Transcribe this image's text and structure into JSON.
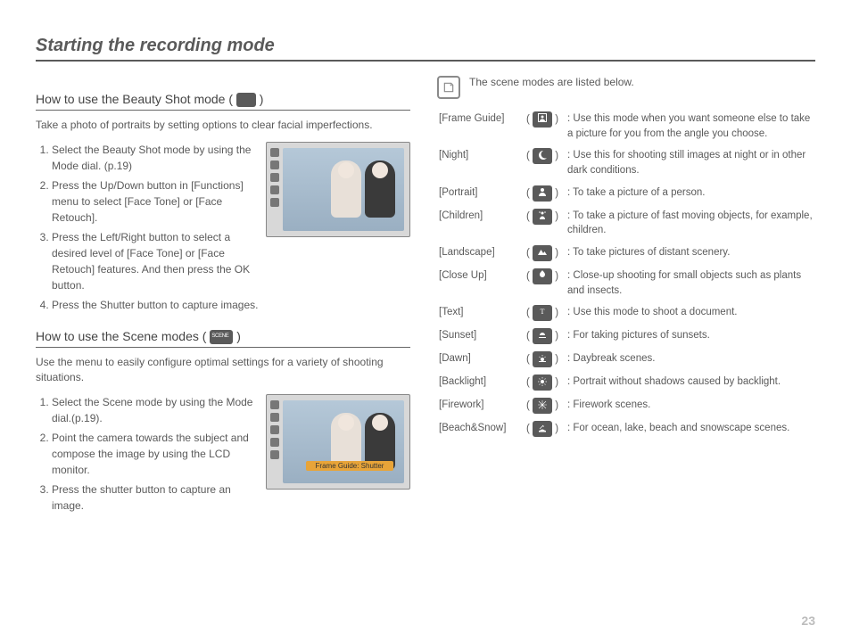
{
  "title": "Starting the recording mode",
  "page_number": "23",
  "beauty": {
    "heading_pre": "How to use the Beauty Shot mode ( ",
    "heading_post": " )",
    "intro": "Take a photo of portraits by setting options to clear facial imperfections.",
    "steps": [
      "Select the Beauty Shot mode by using the Mode dial. (p.19)",
      "Press the Up/Down button in [Functions] menu to select [Face Tone] or [Face Retouch].",
      "Press the Left/Right button to select a desired level of [Face Tone] or [Face Retouch] features. And then press the OK button.",
      "Press the Shutter button to capture images."
    ]
  },
  "scene": {
    "heading_pre": "How to use the Scene modes ( ",
    "heading_post": " )",
    "intro": "Use the menu to easily configure optimal settings for a variety of shooting situations.",
    "steps": [
      "Select the Scene mode by using the Mode dial.(p.19).",
      "Point the camera towards the subject and compose the image by using the LCD monitor.",
      "Press the shutter button to capture an image."
    ],
    "thumb_label": "Frame Guide: Shutter"
  },
  "scene_list": {
    "intro": "The scene modes are listed below.",
    "rows": [
      {
        "name": "[Frame Guide]",
        "icon": "frame-guide",
        "desc": ": Use this mode when you want someone else to take a picture for you from the angle you choose."
      },
      {
        "name": "[Night]",
        "icon": "night",
        "desc": ": Use this for shooting still images at night or in other dark conditions."
      },
      {
        "name": "[Portrait]",
        "icon": "portrait",
        "desc": ": To take a picture of a person."
      },
      {
        "name": "[Children]",
        "icon": "children",
        "desc": ": To take a picture of fast moving objects, for example, children."
      },
      {
        "name": "[Landscape]",
        "icon": "landscape",
        "desc": ": To take pictures of distant scenery."
      },
      {
        "name": "[Close Up]",
        "icon": "closeup",
        "desc": ": Close-up shooting for small objects such as plants and insects."
      },
      {
        "name": "[Text]",
        "icon": "text",
        "desc": ": Use this mode to shoot a document."
      },
      {
        "name": "[Sunset]",
        "icon": "sunset",
        "desc": ": For taking pictures of sunsets."
      },
      {
        "name": "[Dawn]",
        "icon": "dawn",
        "desc": ": Daybreak scenes."
      },
      {
        "name": "[Backlight]",
        "icon": "backlight",
        "desc": ": Portrait without shadows caused by backlight."
      },
      {
        "name": "[Firework]",
        "icon": "firework",
        "desc": ": Firework scenes."
      },
      {
        "name": "[Beach&Snow]",
        "icon": "beachsnow",
        "desc": ": For ocean, lake, beach and snowscape scenes."
      }
    ]
  }
}
